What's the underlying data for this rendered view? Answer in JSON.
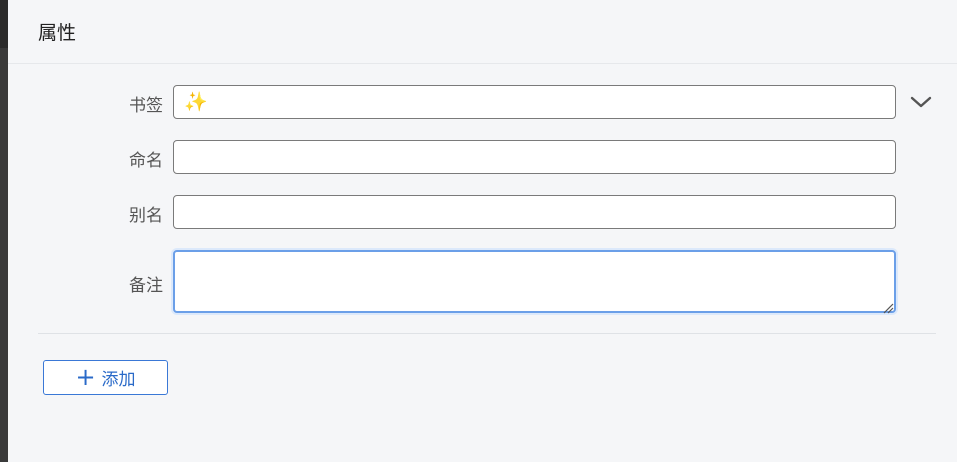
{
  "header": {
    "title": "属性"
  },
  "form": {
    "bookmark": {
      "label": "书签",
      "value": "✨",
      "icon": "chevron-down-icon"
    },
    "name": {
      "label": "命名",
      "value": ""
    },
    "alias": {
      "label": "别名",
      "value": ""
    },
    "memo": {
      "label": "备注",
      "value": ""
    }
  },
  "actions": {
    "add_label": "添加",
    "add_icon": "plus-icon"
  },
  "colors": {
    "accent": "#3a78d6",
    "focus_border": "#6b9fe8"
  }
}
